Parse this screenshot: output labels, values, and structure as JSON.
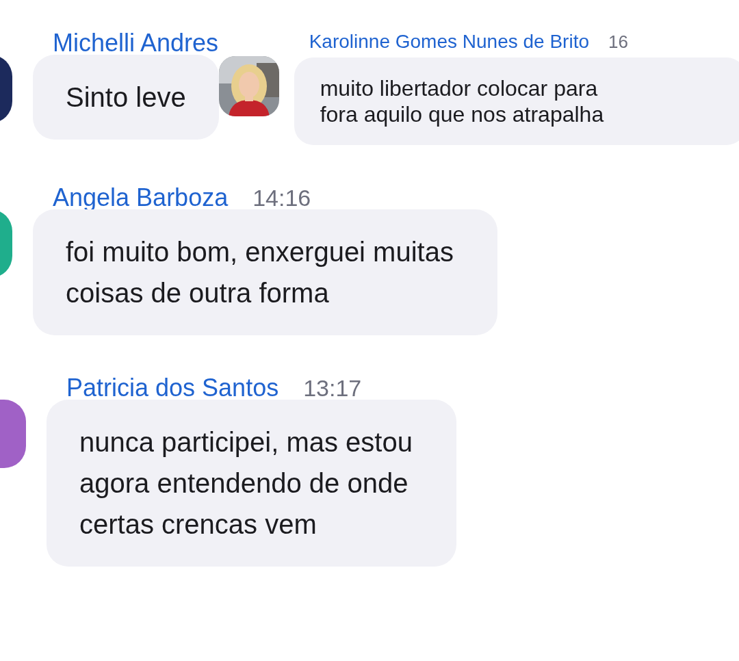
{
  "rows": [
    {
      "messages": [
        {
          "sender": "Michelli Andres",
          "text": "Sinto leve",
          "avatar": {
            "kind": "partial",
            "color": "#1c2a5c"
          },
          "kind": "large"
        },
        {
          "sender": "Karolinne Gomes Nunes de Brito",
          "time": "16",
          "text": "muito libertador colocar para\nfora aquilo que nos atrapalha",
          "kind": "small"
        }
      ]
    },
    {
      "messages": [
        {
          "sender": "Angela Barboza",
          "time": "14:16",
          "text": "foi muito bom, enxerguei muitas\ncoisas de outra forma",
          "avatar": {
            "kind": "partial",
            "color": "#1fae8c"
          },
          "kind": "large"
        }
      ]
    },
    {
      "messages": [
        {
          "sender": "Patricia dos Santos",
          "time": "13:17",
          "text": "nunca participei, mas estou\nagora entendendo de onde\ncertas crencas vem",
          "avatar": {
            "kind": "partial",
            "color": "#a061c6"
          },
          "kind": "large"
        }
      ]
    }
  ]
}
